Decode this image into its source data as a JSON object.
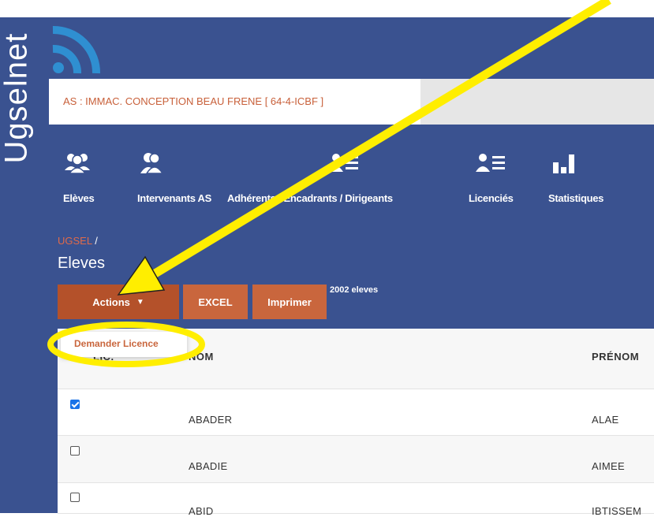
{
  "app": {
    "brand": "Ugselnet"
  },
  "header": {
    "as_label": "AS : IMMAC. CONCEPTION BEAU FRENE [ 64-4-ICBF ]"
  },
  "nav": {
    "items": [
      {
        "label": "Elèves",
        "icon": "users-icon"
      },
      {
        "label": "Intervenants AS",
        "icon": "user-icon"
      },
      {
        "label": "Adhérents / Encadrants / Dirigeants",
        "icon": "user-list-icon"
      },
      {
        "label": "Licenciés",
        "icon": "user-list-icon"
      },
      {
        "label": "Statistiques",
        "icon": "bar-chart-icon"
      }
    ]
  },
  "breadcrumb": {
    "root": "UGSEL",
    "separator": "/"
  },
  "page": {
    "title": "Eleves"
  },
  "toolbar": {
    "actions_label": "Actions",
    "excel_label": "EXCEL",
    "print_label": "Imprimer",
    "count_text": "2002 eleves"
  },
  "dropdown": {
    "item": "Demander Licence"
  },
  "table": {
    "headers": {
      "lic": "LIC.",
      "nom": "NOM",
      "prenom": "PRÉNOM"
    },
    "rows": [
      {
        "checked": true,
        "nom": "ABADER",
        "prenom": "ALAE"
      },
      {
        "checked": false,
        "nom": "ABADIE",
        "prenom": "AIMEE"
      },
      {
        "checked": false,
        "nom": "ABID",
        "prenom": "IBTISSEM"
      }
    ]
  },
  "colors": {
    "sidebar": "#3a5290",
    "accent": "#c9663d",
    "annotation": "#ffee00"
  }
}
